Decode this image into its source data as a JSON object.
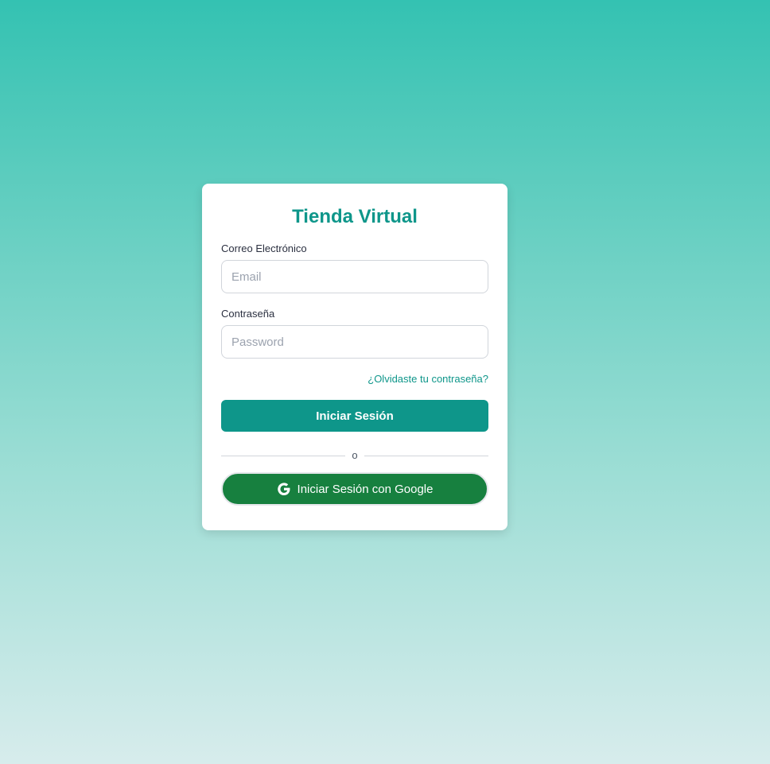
{
  "app": {
    "title": "Tienda Virtual"
  },
  "form": {
    "email_label": "Correo Electrónico",
    "email_placeholder": "Email",
    "email_value": "",
    "password_label": "Contraseña",
    "password_placeholder": "Password",
    "password_value": "",
    "forgot_link": "¿Olvidaste tu contraseña?",
    "submit_label": "Iniciar Sesión",
    "divider_text": "o",
    "google_label": "Iniciar Sesión con Google"
  },
  "icons": {
    "google": "google-icon"
  },
  "colors": {
    "accent": "#0e968a",
    "google_button": "#17803f",
    "background_top": "#34c2b2",
    "background_bottom": "#d7ecec"
  }
}
